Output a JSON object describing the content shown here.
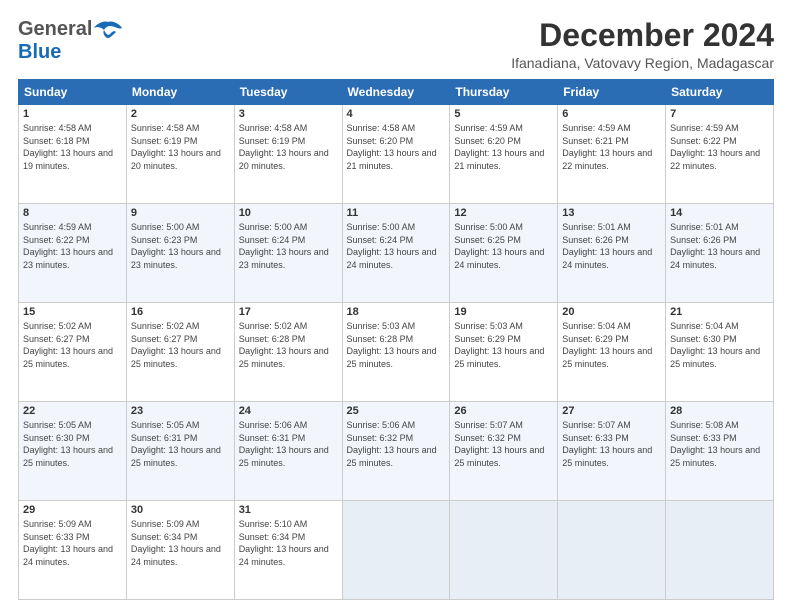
{
  "header": {
    "logo_general": "General",
    "logo_blue": "Blue",
    "title": "December 2024",
    "subtitle": "Ifanadiana, Vatovavy Region, Madagascar"
  },
  "calendar": {
    "days_of_week": [
      "Sunday",
      "Monday",
      "Tuesday",
      "Wednesday",
      "Thursday",
      "Friday",
      "Saturday"
    ],
    "weeks": [
      [
        null,
        {
          "date": 2,
          "sunrise": "4:58 AM",
          "sunset": "6:19 PM",
          "daylight": "13 hours and 20 minutes."
        },
        {
          "date": 3,
          "sunrise": "4:58 AM",
          "sunset": "6:19 PM",
          "daylight": "13 hours and 20 minutes."
        },
        {
          "date": 4,
          "sunrise": "4:58 AM",
          "sunset": "6:20 PM",
          "daylight": "13 hours and 21 minutes."
        },
        {
          "date": 5,
          "sunrise": "4:59 AM",
          "sunset": "6:20 PM",
          "daylight": "13 hours and 21 minutes."
        },
        {
          "date": 6,
          "sunrise": "4:59 AM",
          "sunset": "6:21 PM",
          "daylight": "13 hours and 22 minutes."
        },
        {
          "date": 7,
          "sunrise": "4:59 AM",
          "sunset": "6:22 PM",
          "daylight": "13 hours and 22 minutes."
        }
      ],
      [
        {
          "date": 1,
          "sunrise": "4:58 AM",
          "sunset": "6:18 PM",
          "daylight": "13 hours and 19 minutes."
        },
        {
          "date": 9,
          "sunrise": "5:00 AM",
          "sunset": "6:23 PM",
          "daylight": "13 hours and 23 minutes."
        },
        {
          "date": 10,
          "sunrise": "5:00 AM",
          "sunset": "6:24 PM",
          "daylight": "13 hours and 23 minutes."
        },
        {
          "date": 11,
          "sunrise": "5:00 AM",
          "sunset": "6:24 PM",
          "daylight": "13 hours and 24 minutes."
        },
        {
          "date": 12,
          "sunrise": "5:00 AM",
          "sunset": "6:25 PM",
          "daylight": "13 hours and 24 minutes."
        },
        {
          "date": 13,
          "sunrise": "5:01 AM",
          "sunset": "6:26 PM",
          "daylight": "13 hours and 24 minutes."
        },
        {
          "date": 14,
          "sunrise": "5:01 AM",
          "sunset": "6:26 PM",
          "daylight": "13 hours and 24 minutes."
        }
      ],
      [
        {
          "date": 8,
          "sunrise": "4:59 AM",
          "sunset": "6:22 PM",
          "daylight": "13 hours and 23 minutes."
        },
        {
          "date": 16,
          "sunrise": "5:02 AM",
          "sunset": "6:27 PM",
          "daylight": "13 hours and 25 minutes."
        },
        {
          "date": 17,
          "sunrise": "5:02 AM",
          "sunset": "6:28 PM",
          "daylight": "13 hours and 25 minutes."
        },
        {
          "date": 18,
          "sunrise": "5:03 AM",
          "sunset": "6:28 PM",
          "daylight": "13 hours and 25 minutes."
        },
        {
          "date": 19,
          "sunrise": "5:03 AM",
          "sunset": "6:29 PM",
          "daylight": "13 hours and 25 minutes."
        },
        {
          "date": 20,
          "sunrise": "5:04 AM",
          "sunset": "6:29 PM",
          "daylight": "13 hours and 25 minutes."
        },
        {
          "date": 21,
          "sunrise": "5:04 AM",
          "sunset": "6:30 PM",
          "daylight": "13 hours and 25 minutes."
        }
      ],
      [
        {
          "date": 15,
          "sunrise": "5:02 AM",
          "sunset": "6:27 PM",
          "daylight": "13 hours and 25 minutes."
        },
        {
          "date": 23,
          "sunrise": "5:05 AM",
          "sunset": "6:31 PM",
          "daylight": "13 hours and 25 minutes."
        },
        {
          "date": 24,
          "sunrise": "5:06 AM",
          "sunset": "6:31 PM",
          "daylight": "13 hours and 25 minutes."
        },
        {
          "date": 25,
          "sunrise": "5:06 AM",
          "sunset": "6:32 PM",
          "daylight": "13 hours and 25 minutes."
        },
        {
          "date": 26,
          "sunrise": "5:07 AM",
          "sunset": "6:32 PM",
          "daylight": "13 hours and 25 minutes."
        },
        {
          "date": 27,
          "sunrise": "5:07 AM",
          "sunset": "6:33 PM",
          "daylight": "13 hours and 25 minutes."
        },
        {
          "date": 28,
          "sunrise": "5:08 AM",
          "sunset": "6:33 PM",
          "daylight": "13 hours and 25 minutes."
        }
      ],
      [
        {
          "date": 22,
          "sunrise": "5:05 AM",
          "sunset": "6:30 PM",
          "daylight": "13 hours and 25 minutes."
        },
        {
          "date": 30,
          "sunrise": "5:09 AM",
          "sunset": "6:34 PM",
          "daylight": "13 hours and 24 minutes."
        },
        {
          "date": 31,
          "sunrise": "5:10 AM",
          "sunset": "6:34 PM",
          "daylight": "13 hours and 24 minutes."
        },
        null,
        null,
        null,
        null
      ],
      [
        {
          "date": 29,
          "sunrise": "5:09 AM",
          "sunset": "6:33 PM",
          "daylight": "13 hours and 24 minutes."
        },
        null,
        null,
        null,
        null,
        null,
        null
      ]
    ],
    "proper_weeks": [
      [
        {
          "date": 1,
          "sunrise": "4:58 AM",
          "sunset": "6:18 PM",
          "daylight": "13 hours and 19 minutes."
        },
        {
          "date": 2,
          "sunrise": "4:58 AM",
          "sunset": "6:19 PM",
          "daylight": "13 hours and 20 minutes."
        },
        {
          "date": 3,
          "sunrise": "4:58 AM",
          "sunset": "6:19 PM",
          "daylight": "13 hours and 20 minutes."
        },
        {
          "date": 4,
          "sunrise": "4:58 AM",
          "sunset": "6:20 PM",
          "daylight": "13 hours and 21 minutes."
        },
        {
          "date": 5,
          "sunrise": "4:59 AM",
          "sunset": "6:20 PM",
          "daylight": "13 hours and 21 minutes."
        },
        {
          "date": 6,
          "sunrise": "4:59 AM",
          "sunset": "6:21 PM",
          "daylight": "13 hours and 22 minutes."
        },
        {
          "date": 7,
          "sunrise": "4:59 AM",
          "sunset": "6:22 PM",
          "daylight": "13 hours and 22 minutes."
        }
      ],
      [
        {
          "date": 8,
          "sunrise": "4:59 AM",
          "sunset": "6:22 PM",
          "daylight": "13 hours and 23 minutes."
        },
        {
          "date": 9,
          "sunrise": "5:00 AM",
          "sunset": "6:23 PM",
          "daylight": "13 hours and 23 minutes."
        },
        {
          "date": 10,
          "sunrise": "5:00 AM",
          "sunset": "6:24 PM",
          "daylight": "13 hours and 23 minutes."
        },
        {
          "date": 11,
          "sunrise": "5:00 AM",
          "sunset": "6:24 PM",
          "daylight": "13 hours and 24 minutes."
        },
        {
          "date": 12,
          "sunrise": "5:00 AM",
          "sunset": "6:25 PM",
          "daylight": "13 hours and 24 minutes."
        },
        {
          "date": 13,
          "sunrise": "5:01 AM",
          "sunset": "6:26 PM",
          "daylight": "13 hours and 24 minutes."
        },
        {
          "date": 14,
          "sunrise": "5:01 AM",
          "sunset": "6:26 PM",
          "daylight": "13 hours and 24 minutes."
        }
      ],
      [
        {
          "date": 15,
          "sunrise": "5:02 AM",
          "sunset": "6:27 PM",
          "daylight": "13 hours and 25 minutes."
        },
        {
          "date": 16,
          "sunrise": "5:02 AM",
          "sunset": "6:27 PM",
          "daylight": "13 hours and 25 minutes."
        },
        {
          "date": 17,
          "sunrise": "5:02 AM",
          "sunset": "6:28 PM",
          "daylight": "13 hours and 25 minutes."
        },
        {
          "date": 18,
          "sunrise": "5:03 AM",
          "sunset": "6:28 PM",
          "daylight": "13 hours and 25 minutes."
        },
        {
          "date": 19,
          "sunrise": "5:03 AM",
          "sunset": "6:29 PM",
          "daylight": "13 hours and 25 minutes."
        },
        {
          "date": 20,
          "sunrise": "5:04 AM",
          "sunset": "6:29 PM",
          "daylight": "13 hours and 25 minutes."
        },
        {
          "date": 21,
          "sunrise": "5:04 AM",
          "sunset": "6:30 PM",
          "daylight": "13 hours and 25 minutes."
        }
      ],
      [
        {
          "date": 22,
          "sunrise": "5:05 AM",
          "sunset": "6:30 PM",
          "daylight": "13 hours and 25 minutes."
        },
        {
          "date": 23,
          "sunrise": "5:05 AM",
          "sunset": "6:31 PM",
          "daylight": "13 hours and 25 minutes."
        },
        {
          "date": 24,
          "sunrise": "5:06 AM",
          "sunset": "6:31 PM",
          "daylight": "13 hours and 25 minutes."
        },
        {
          "date": 25,
          "sunrise": "5:06 AM",
          "sunset": "6:32 PM",
          "daylight": "13 hours and 25 minutes."
        },
        {
          "date": 26,
          "sunrise": "5:07 AM",
          "sunset": "6:32 PM",
          "daylight": "13 hours and 25 minutes."
        },
        {
          "date": 27,
          "sunrise": "5:07 AM",
          "sunset": "6:33 PM",
          "daylight": "13 hours and 25 minutes."
        },
        {
          "date": 28,
          "sunrise": "5:08 AM",
          "sunset": "6:33 PM",
          "daylight": "13 hours and 25 minutes."
        }
      ],
      [
        {
          "date": 29,
          "sunrise": "5:09 AM",
          "sunset": "6:33 PM",
          "daylight": "13 hours and 24 minutes."
        },
        {
          "date": 30,
          "sunrise": "5:09 AM",
          "sunset": "6:34 PM",
          "daylight": "13 hours and 24 minutes."
        },
        {
          "date": 31,
          "sunrise": "5:10 AM",
          "sunset": "6:34 PM",
          "daylight": "13 hours and 24 minutes."
        },
        null,
        null,
        null,
        null
      ]
    ]
  }
}
